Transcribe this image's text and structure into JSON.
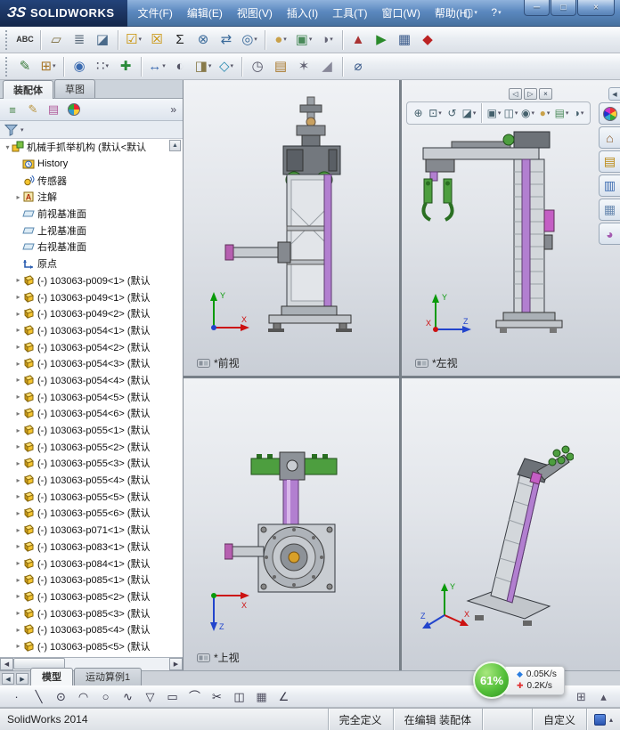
{
  "titlebar": {
    "logo_mark": "ЗS",
    "logo_text": "SOLIDWORKS",
    "menus": [
      "文件(F)",
      "编辑(E)",
      "视图(V)",
      "插入(I)",
      "工具(T)",
      "窗口(W)",
      "帮助(H)"
    ],
    "quick_icons": [
      {
        "name": "new-document",
        "glyph": "▢",
        "color": "#ffffff",
        "dropdown": true
      },
      {
        "name": "help",
        "glyph": "?",
        "color": "#ffffff",
        "dropdown": true
      }
    ],
    "window_buttons": [
      {
        "name": "minimize-button",
        "glyph": "─"
      },
      {
        "name": "maximize-button",
        "glyph": "□"
      },
      {
        "name": "close-button",
        "glyph": "×"
      }
    ]
  },
  "toolbar_main": [
    {
      "name": "spell-checker",
      "glyph": "ABC",
      "color": "#333333",
      "small": true
    },
    {
      "sep": true
    },
    {
      "name": "measure-tool",
      "glyph": "▱",
      "color": "#7a6a3a"
    },
    {
      "name": "mass-properties",
      "glyph": "≣",
      "color": "#5a6a7a"
    },
    {
      "name": "section-properties",
      "glyph": "◪",
      "color": "#4a6a8a"
    },
    {
      "sep": true
    },
    {
      "name": "design-checker",
      "glyph": "☑",
      "color": "#c89000",
      "dropdown": true
    },
    {
      "name": "check-document",
      "glyph": "☒",
      "color": "#c89000"
    },
    {
      "name": "equations",
      "glyph": "Σ",
      "color": "#222222"
    },
    {
      "name": "interference-detection",
      "glyph": "⊗",
      "color": "#3a6a9a"
    },
    {
      "name": "clearance-verification",
      "glyph": "⇄",
      "color": "#3a6a9a"
    },
    {
      "name": "hole-alignment",
      "glyph": "◎",
      "color": "#3a6a9a",
      "dropdown": true
    },
    {
      "sep": true
    },
    {
      "name": "edit-appearance",
      "glyph": "●",
      "color": "#c9a14a",
      "dropdown": true
    },
    {
      "name": "apply-scene",
      "glyph": "▣",
      "color": "#4a8a5a",
      "dropdown": true
    },
    {
      "name": "view-settings",
      "glyph": "◑",
      "color": "#666677",
      "dropdown": true
    },
    {
      "sep": true
    },
    {
      "name": "simulationxpress",
      "glyph": "▲",
      "color": "#aa3333"
    },
    {
      "name": "motion-manager",
      "glyph": "▶",
      "color": "#2a8a2a"
    },
    {
      "name": "toolbox-library",
      "glyph": "▦",
      "color": "#3a5a8a"
    },
    {
      "name": "photoview-render",
      "glyph": "◆",
      "color": "#bb2222"
    }
  ],
  "toolbar_assembly": [
    {
      "name": "edit-component",
      "glyph": "✎",
      "color": "#3a7a3a"
    },
    {
      "name": "insert-components",
      "glyph": "⊞",
      "color": "#a8772a",
      "dropdown": true
    },
    {
      "sep": true
    },
    {
      "name": "mate",
      "glyph": "◉",
      "color": "#3a6ab0"
    },
    {
      "name": "linear-component-pattern",
      "glyph": "∷",
      "color": "#555566",
      "dropdown": true
    },
    {
      "name": "smart-fasteners",
      "glyph": "✚",
      "color": "#2a8a3a"
    },
    {
      "sep": true
    },
    {
      "name": "move-component",
      "glyph": "↔",
      "color": "#3a6ab0",
      "dropdown": true
    },
    {
      "name": "show-hidden-components",
      "glyph": "◐",
      "color": "#555566"
    },
    {
      "name": "assembly-features",
      "glyph": "◨",
      "color": "#887a4a",
      "dropdown": true
    },
    {
      "name": "reference-geometry",
      "glyph": "◇",
      "color": "#2a8ab0",
      "dropdown": true
    },
    {
      "sep": true
    },
    {
      "name": "new-motion-study",
      "glyph": "◷",
      "color": "#555566"
    },
    {
      "name": "bill-of-materials",
      "glyph": "▤",
      "color": "#a8772a"
    },
    {
      "name": "exploded-view",
      "glyph": "✶",
      "color": "#666677"
    },
    {
      "name": "instant3d",
      "glyph": "◢",
      "color": "#888899"
    },
    {
      "sep": true
    },
    {
      "name": "smart-dimension",
      "glyph": "⌀",
      "color": "#3a5a8a"
    }
  ],
  "panel": {
    "tabs": [
      {
        "label": "装配体",
        "active": true
      },
      {
        "label": "草图",
        "active": false
      }
    ],
    "manager_icons": [
      {
        "name": "featuremanager-tree-icon",
        "glyph": "≡",
        "color": "#3a7a3a"
      },
      {
        "name": "propertymanager-icon",
        "glyph": "✎",
        "color": "#b8923a"
      },
      {
        "name": "configurationmanager-icon",
        "glyph": "▤",
        "color": "#b05a9a"
      },
      {
        "name": "displaymanager-icon",
        "pie": true
      }
    ],
    "overflow_glyph": "»",
    "tree": [
      {
        "icon": "assembly",
        "expander": "▾",
        "indent": 0,
        "label": "机械手抓举机构 (默认<默认"
      },
      {
        "icon": "history",
        "indent": 1,
        "label": "History"
      },
      {
        "icon": "sensor",
        "indent": 1,
        "label": "传感器"
      },
      {
        "icon": "annotation",
        "expander": "▸",
        "indent": 1,
        "label": "注解"
      },
      {
        "icon": "plane",
        "indent": 1,
        "label": "前视基准面"
      },
      {
        "icon": "plane",
        "indent": 1,
        "label": "上视基准面"
      },
      {
        "icon": "plane",
        "indent": 1,
        "label": "右视基准面"
      },
      {
        "icon": "origin",
        "indent": 1,
        "label": "原点"
      },
      {
        "icon": "part",
        "expander": "▸",
        "indent": 1,
        "label": "(-) 103063-p009<1> (默认"
      },
      {
        "icon": "part",
        "expander": "▸",
        "indent": 1,
        "label": "(-) 103063-p049<1> (默认"
      },
      {
        "icon": "part",
        "expander": "▸",
        "indent": 1,
        "label": "(-) 103063-p049<2> (默认"
      },
      {
        "icon": "part",
        "expander": "▸",
        "indent": 1,
        "label": "(-) 103063-p054<1> (默认"
      },
      {
        "icon": "part",
        "expander": "▸",
        "indent": 1,
        "label": "(-) 103063-p054<2> (默认"
      },
      {
        "icon": "part",
        "expander": "▸",
        "indent": 1,
        "label": "(-) 103063-p054<3> (默认"
      },
      {
        "icon": "part",
        "expander": "▸",
        "indent": 1,
        "label": "(-) 103063-p054<4> (默认"
      },
      {
        "icon": "part",
        "expander": "▸",
        "indent": 1,
        "label": "(-) 103063-p054<5> (默认"
      },
      {
        "icon": "part",
        "expander": "▸",
        "indent": 1,
        "label": "(-) 103063-p054<6> (默认"
      },
      {
        "icon": "part",
        "expander": "▸",
        "indent": 1,
        "label": "(-) 103063-p055<1> (默认"
      },
      {
        "icon": "part",
        "expander": "▸",
        "indent": 1,
        "label": "(-) 103063-p055<2> (默认"
      },
      {
        "icon": "part",
        "expander": "▸",
        "indent": 1,
        "label": "(-) 103063-p055<3> (默认"
      },
      {
        "icon": "part",
        "expander": "▸",
        "indent": 1,
        "label": "(-) 103063-p055<4> (默认"
      },
      {
        "icon": "part",
        "expander": "▸",
        "indent": 1,
        "label": "(-) 103063-p055<5> (默认"
      },
      {
        "icon": "part",
        "expander": "▸",
        "indent": 1,
        "label": "(-) 103063-p055<6> (默认"
      },
      {
        "icon": "part",
        "expander": "▸",
        "indent": 1,
        "label": "(-) 103063-p071<1> (默认"
      },
      {
        "icon": "part",
        "expander": "▸",
        "indent": 1,
        "label": "(-) 103063-p083<1> (默认"
      },
      {
        "icon": "part",
        "expander": "▸",
        "indent": 1,
        "label": "(-) 103063-p084<1> (默认"
      },
      {
        "icon": "part",
        "expander": "▸",
        "indent": 1,
        "label": "(-) 103063-p085<1> (默认"
      },
      {
        "icon": "part",
        "expander": "▸",
        "indent": 1,
        "label": "(-) 103063-p085<2> (默认"
      },
      {
        "icon": "part",
        "expander": "▸",
        "indent": 1,
        "label": "(-) 103063-p085<3> (默认"
      },
      {
        "icon": "part",
        "expander": "▸",
        "indent": 1,
        "label": "(-) 103063-p085<4> (默认"
      },
      {
        "icon": "part",
        "expander": "▸",
        "indent": 1,
        "label": "(-) 103063-p085<5> (默认"
      }
    ]
  },
  "viewports": {
    "panes": [
      {
        "label": "*前视"
      },
      {
        "label": "*左视"
      },
      {
        "label": "*上视"
      },
      {
        "label": ""
      }
    ],
    "window_controls": [
      {
        "name": "pane-previous-button",
        "glyph": "◁"
      },
      {
        "name": "pane-next-button",
        "glyph": "▷"
      },
      {
        "name": "pane-close-button",
        "glyph": "×"
      }
    ],
    "headsup": [
      {
        "name": "zoom-to-fit",
        "glyph": "⊕",
        "color": "#44606c"
      },
      {
        "name": "zoom-to-area",
        "glyph": "⊡",
        "color": "#44606c",
        "dropdown": true
      },
      {
        "name": "previous-view",
        "glyph": "↺",
        "color": "#44606c"
      },
      {
        "name": "section-view",
        "glyph": "◪",
        "color": "#44606c",
        "dropdown": true
      },
      {
        "sep": true
      },
      {
        "name": "view-orientation",
        "glyph": "▣",
        "color": "#44606c",
        "dropdown": true
      },
      {
        "name": "display-style",
        "glyph": "◫",
        "color": "#44606c",
        "dropdown": true
      },
      {
        "name": "hide-show-items",
        "glyph": "◉",
        "color": "#44606c",
        "dropdown": true
      },
      {
        "name": "edit-appearance-hud",
        "glyph": "●",
        "color": "#c9a14a",
        "dropdown": true
      },
      {
        "name": "apply-scene-hud",
        "glyph": "▤",
        "color": "#4a8a5a",
        "dropdown": true
      },
      {
        "name": "view-settings-hud",
        "glyph": "◑",
        "color": "#44606c",
        "dropdown": true
      }
    ]
  },
  "taskpane": [
    {
      "name": "taskpane-collapse-button",
      "collapse": true
    },
    {
      "name": "appearances-ball-tab",
      "ball": true
    },
    {
      "name": "solidworks-resources-tab",
      "glyph": "⌂",
      "color": "#8a5a2a"
    },
    {
      "name": "design-library-tab",
      "glyph": "▤",
      "color": "#b8860b"
    },
    {
      "name": "file-explorer-tab",
      "glyph": "▥",
      "color": "#3a6ab0"
    },
    {
      "name": "view-palette-tab",
      "glyph": "▦",
      "color": "#6a8ab0"
    },
    {
      "name": "appearances-scenes-tab",
      "glyph": "◕",
      "color": "#a45ab0"
    }
  ],
  "doc_tabs": {
    "tabs": [
      {
        "label": "模型",
        "active": true
      },
      {
        "label": "运动算例1",
        "active": false
      }
    ]
  },
  "sketch_toolbar": [
    {
      "name": "sketch-point",
      "glyph": "·",
      "color": "#333344"
    },
    {
      "name": "sketch-line",
      "glyph": "╲",
      "color": "#333344"
    },
    {
      "name": "sketch-circle",
      "glyph": "⊙",
      "color": "#333344"
    },
    {
      "name": "sketch-arc",
      "glyph": "◠",
      "color": "#333344"
    },
    {
      "name": "sketch-ellipse",
      "glyph": "○",
      "color": "#333344"
    },
    {
      "name": "sketch-spline",
      "glyph": "∿",
      "color": "#333344"
    },
    {
      "name": "sketch-polygon",
      "glyph": "▽",
      "color": "#333344"
    },
    {
      "name": "sketch-rectangle",
      "glyph": "▭",
      "color": "#333344"
    },
    {
      "name": "sketch-fillet",
      "glyph": "⌒",
      "color": "#333344"
    },
    {
      "name": "sketch-trim",
      "glyph": "✂",
      "color": "#333344"
    },
    {
      "name": "sketch-mirror",
      "glyph": "◫",
      "color": "#333344"
    },
    {
      "name": "sketch-grid",
      "glyph": "▦",
      "color": "#555566"
    },
    {
      "name": "sketch-angle",
      "glyph": "∠",
      "color": "#333344"
    }
  ],
  "sketch_toolbar_right": [
    {
      "name": "grid-system",
      "glyph": "⊞",
      "color": "#555566"
    },
    {
      "name": "expand-toolbar",
      "glyph": "▴",
      "color": "#555566"
    }
  ],
  "statusbar": {
    "app": "SolidWorks 2014",
    "cells": [
      "完全定义",
      "在编辑 装配体"
    ],
    "custom": "自定义"
  },
  "overlay_badge": {
    "percent": "61%",
    "down_speed": "0.05K/s",
    "up_speed": "0.2K/s"
  }
}
